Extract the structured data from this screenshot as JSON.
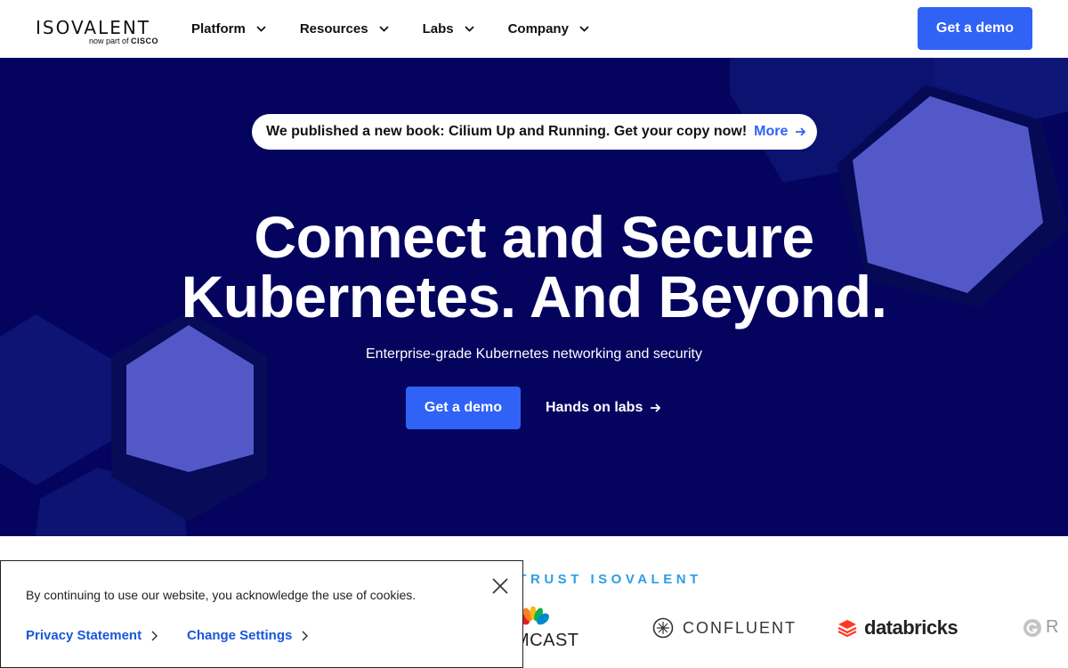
{
  "header": {
    "logo_main": "ISOVALENT",
    "logo_sub_prefix": "now part of",
    "logo_sub_brand": "CISCO",
    "nav": [
      {
        "label": "Platform"
      },
      {
        "label": "Resources"
      },
      {
        "label": "Labs"
      },
      {
        "label": "Company"
      }
    ],
    "cta_label": "Get a demo"
  },
  "hero": {
    "announcement": "We published a new book: Cilium Up and Running. Get your copy now!",
    "announcement_link": "More",
    "title_line1": "Connect and Secure",
    "title_line2": "Kubernetes. And Beyond.",
    "subtitle": "Enterprise-grade Kubernetes networking and security",
    "primary_cta": "Get a demo",
    "secondary_cta": "Hands on labs"
  },
  "trust": {
    "heading": "T TRUST ISOVALENT",
    "brands": [
      {
        "name": "MCAST"
      },
      {
        "name": "CONFLUENT"
      },
      {
        "name": "databricks"
      },
      {
        "name": "R"
      }
    ]
  },
  "cookie": {
    "message": "By continuing to use our website, you acknowledge the use of cookies.",
    "privacy_label": "Privacy Statement",
    "settings_label": "Change Settings"
  },
  "colors": {
    "primary": "#3062f5",
    "hero_bg": "#04045f",
    "hex_light": "#5358c9",
    "trust_heading": "#2d9ee6"
  }
}
